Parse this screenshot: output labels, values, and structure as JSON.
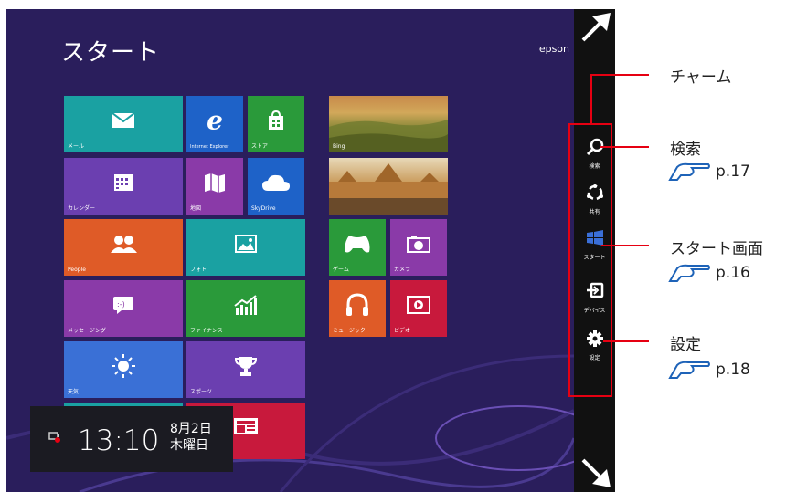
{
  "screen": {
    "title": "スタート",
    "user": "epson"
  },
  "tiles": [
    {
      "id": "mail",
      "label": "メール",
      "color": "#1aa1a2",
      "icon": "mail-icon"
    },
    {
      "id": "ie",
      "label": "Internet Explorer",
      "color": "#1e62c8",
      "icon": "internet-explorer-icon"
    },
    {
      "id": "store",
      "label": "ストア",
      "color": "#2a9a3a",
      "icon": "store-icon"
    },
    {
      "id": "calendar",
      "label": "カレンダー",
      "color": "#6b3fb0",
      "icon": "calendar-icon"
    },
    {
      "id": "maps",
      "label": "地図",
      "color": "#8a3aa8",
      "icon": "map-icon"
    },
    {
      "id": "skydrive",
      "label": "SkyDrive",
      "color": "#1e62c8",
      "icon": "cloud-icon"
    },
    {
      "id": "people",
      "label": "People",
      "color": "#df5b27",
      "icon": "people-icon"
    },
    {
      "id": "photos",
      "label": "フォト",
      "color": "#1aa1a2",
      "icon": "photo-icon"
    },
    {
      "id": "messaging",
      "label": "メッセージング",
      "color": "#8a3aa8",
      "icon": "messaging-icon"
    },
    {
      "id": "finance",
      "label": "ファイナンス",
      "color": "#2a9a3a",
      "icon": "finance-icon"
    },
    {
      "id": "weather",
      "label": "天気",
      "color": "#3a70d6",
      "icon": "sun-icon"
    },
    {
      "id": "sports",
      "label": "スポーツ",
      "color": "#6b3fb0",
      "icon": "trophy-icon"
    },
    {
      "id": "bing",
      "label": "Bing",
      "color": "#9a7a2a",
      "icon": "landscape-image"
    },
    {
      "id": "travel",
      "label": "",
      "color": "#b07a3a",
      "icon": "city-image"
    },
    {
      "id": "games",
      "label": "ゲーム",
      "color": "#2a9a3a",
      "icon": "gamepad-icon"
    },
    {
      "id": "camera",
      "label": "カメラ",
      "color": "#8a3aa8",
      "icon": "camera-icon"
    },
    {
      "id": "music",
      "label": "ミュージック",
      "color": "#df5b27",
      "icon": "headphones-icon"
    },
    {
      "id": "video",
      "label": "ビデオ",
      "color": "#c8193c",
      "icon": "video-icon"
    }
  ],
  "clock": {
    "time": "13:10",
    "date_line1": "8月2日",
    "date_line2": "木曜日"
  },
  "charms": [
    {
      "label": "検索",
      "icon": "search-icon"
    },
    {
      "label": "共有",
      "icon": "share-icon"
    },
    {
      "label": "スタート",
      "icon": "windows-icon"
    },
    {
      "label": "デバイス",
      "icon": "devices-icon"
    },
    {
      "label": "設定",
      "icon": "gear-icon"
    }
  ],
  "annotations": {
    "charm": "チャーム",
    "search": "検索",
    "search_ref": "p.17",
    "start": "スタート画面",
    "start_ref": "p.16",
    "settings": "設定",
    "settings_ref": "p.18"
  }
}
